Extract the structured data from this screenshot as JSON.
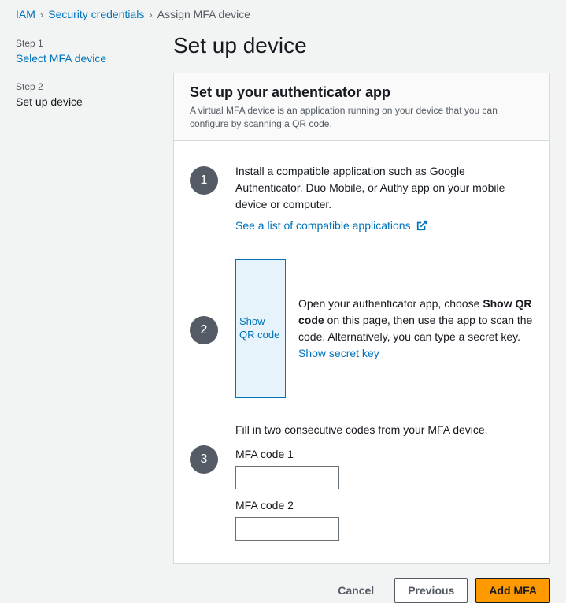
{
  "breadcrumb": {
    "items": [
      "IAM",
      "Security credentials"
    ],
    "current": "Assign MFA device"
  },
  "sidebar": {
    "step1": {
      "label": "Step 1",
      "title": "Select MFA device"
    },
    "step2": {
      "label": "Step 2",
      "title": "Set up device"
    }
  },
  "page_title": "Set up device",
  "panel": {
    "title": "Set up your authenticator app",
    "description": "A virtual MFA device is an application running on your device that you can configure by scanning a QR code."
  },
  "steps": {
    "one": {
      "num": "1",
      "text": "Install a compatible application such as Google Authenticator, Duo Mobile, or Authy app on your mobile device or computer.",
      "link": "See a list of compatible applications"
    },
    "two": {
      "num": "2",
      "qr_label": "Show QR code",
      "text_pre": "Open your authenticator app, choose ",
      "text_bold": "Show QR code",
      "text_post": " on this page, then use the app to scan the code. Alternatively, you can type a secret key.",
      "secret_link": "Show secret key"
    },
    "three": {
      "num": "3",
      "intro": "Fill in two consecutive codes from your MFA device.",
      "code1_label": "MFA code 1",
      "code1_value": "",
      "code2_label": "MFA code 2",
      "code2_value": ""
    }
  },
  "footer": {
    "cancel": "Cancel",
    "previous": "Previous",
    "add": "Add MFA"
  }
}
